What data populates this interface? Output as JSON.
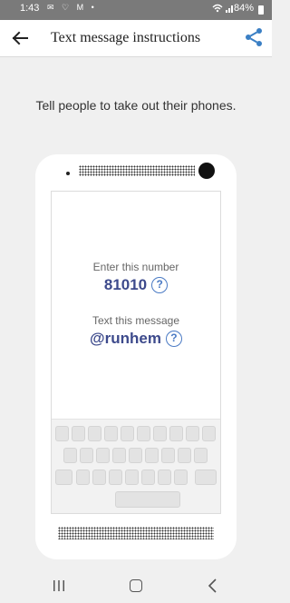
{
  "status_bar": {
    "time": "1:43",
    "notification_icons": "✉ ♡ M •",
    "system_icons": "📶 ᵢₗ",
    "battery": "84%"
  },
  "app_bar": {
    "title": "Text message instructions",
    "back_icon": "arrow-left",
    "share_icon": "share",
    "accent_color": "#3a7fc4"
  },
  "instruction": "Tell people to take out their phones.",
  "phone_screen": {
    "number_label": "Enter this number",
    "number": "81010",
    "message_label": "Text this message",
    "message": "@runhem",
    "help_symbol": "?",
    "value_color": "#3d4a8c"
  },
  "nav_bar": {
    "recents_icon": "recents",
    "home_icon": "home",
    "back_icon": "back"
  }
}
